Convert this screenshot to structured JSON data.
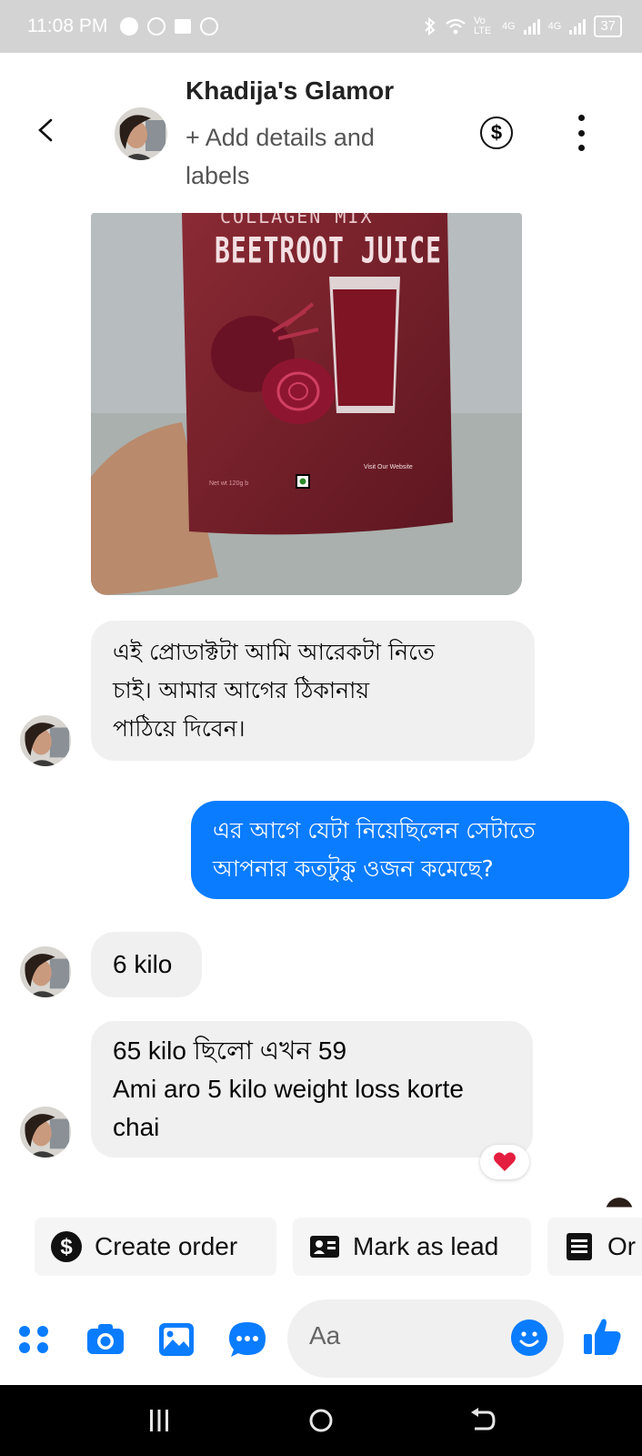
{
  "status_bar": {
    "time": "11:08 PM",
    "network_label": "Vo LTE",
    "signal_1": "4G",
    "signal_2": "4G",
    "battery": "37"
  },
  "header": {
    "title": "Khadija's Glamor",
    "subtitle": "+ Add details and labels"
  },
  "photo": {
    "product_name": "BEETROOT JUICE",
    "product_top": "COLLAGEN MIX",
    "visit_text": "Visit Our Website",
    "weight_text": "Net wt 120g b"
  },
  "messages": [
    {
      "direction": "incoming",
      "lines": [
        "এই প্রোডাক্টটা আমি আরেকটা নিতে",
        "চাই। আমার আগের ঠিকানায়",
        "পাঠিয়ে দিবেন।"
      ]
    },
    {
      "direction": "outgoing",
      "lines": [
        "এর আগে যেটা নিয়েছিলেন সেটাতে",
        "আপনার কতটুকু ওজন কমেছে?"
      ]
    },
    {
      "direction": "incoming",
      "lines": [
        "6 kilo"
      ]
    },
    {
      "direction": "incoming",
      "lines": [
        "65 kilo ছিলো এখন 59",
        "Ami aro 5 kilo weight loss korte",
        "chai"
      ],
      "reaction": "heart"
    }
  ],
  "quick_actions": [
    {
      "label": "Create order",
      "icon": "dollar-circle-icon"
    },
    {
      "label": "Mark as lead",
      "icon": "contact-card-icon"
    },
    {
      "label": "Or",
      "icon": "document-icon"
    }
  ],
  "composer": {
    "placeholder": "Aa",
    "icons": [
      "apps-icon",
      "camera-icon",
      "gallery-icon",
      "more-icon",
      "emoji-icon",
      "like-icon"
    ]
  },
  "nav_bar": {
    "icons": [
      "recent-apps-icon",
      "home-icon",
      "back-icon"
    ]
  },
  "colors": {
    "accent": "#0a7cff",
    "incoming_bubble": "#f0f0f0",
    "status_bar": "#d3d3d3",
    "reaction_heart": "#e41e3f"
  }
}
